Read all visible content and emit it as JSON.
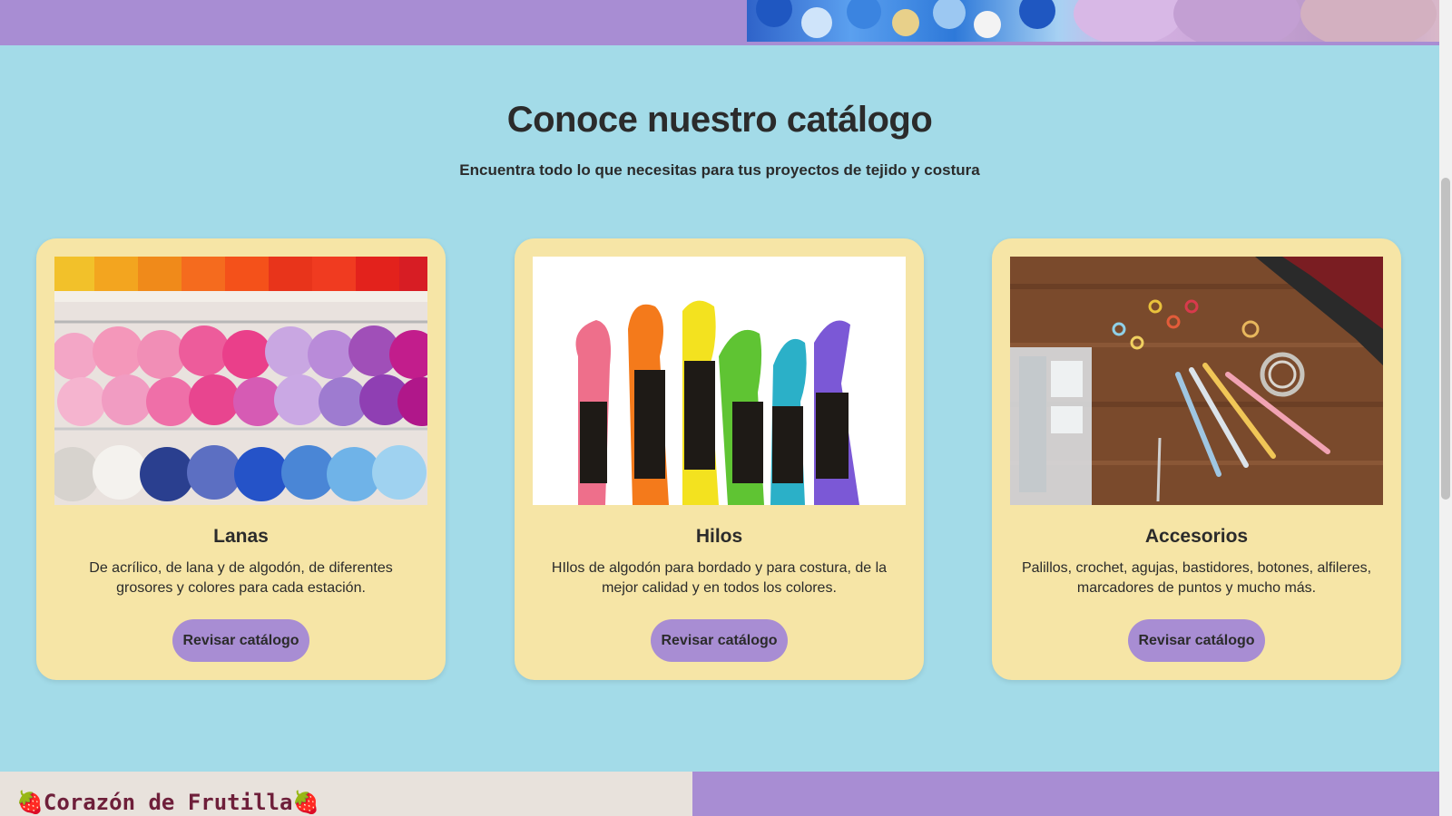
{
  "catalog": {
    "title": "Conoce nuestro catálogo",
    "subtitle": "Encuentra todo lo que necesitas para tus proyectos de tejido y costura"
  },
  "cards": [
    {
      "title": "Lanas",
      "description": "De acrílico, de lana y de algodón, de diferentes grosores y colores para cada estación.",
      "button_label": "Revisar catálogo",
      "image_name": "yarn-skeins-photo"
    },
    {
      "title": "Hilos",
      "description": "HIlos de algodón para bordado y para costura, de la mejor calidad y en todos los colores.",
      "button_label": "Revisar catálogo",
      "image_name": "embroidery-threads-photo"
    },
    {
      "title": "Accesorios",
      "description": "Palillos, crochet, agujas, bastidores, botones, alfileres, marcadores de puntos y mucho más.",
      "button_label": "Revisar catálogo",
      "image_name": "knitting-accessories-photo"
    }
  ],
  "footer": {
    "brand": "🍓Corazón de Frutilla🍓"
  },
  "colors": {
    "section_background": "#a3dbe8",
    "card_background": "#f6e5a6",
    "accent_purple": "#a88dd3",
    "text": "#2b2b2b"
  }
}
